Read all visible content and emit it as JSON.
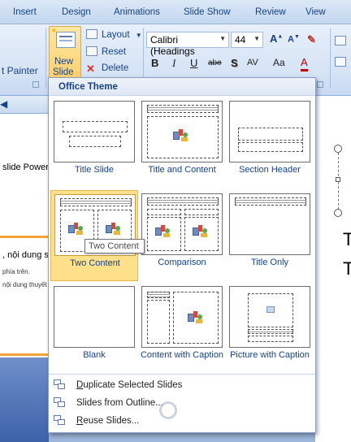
{
  "ribbon_tabs": [
    "Insert",
    "Design",
    "Animations",
    "Slide Show",
    "Review",
    "View"
  ],
  "clipboard": {
    "format_painter_label": "t Painter"
  },
  "slides_group": {
    "new_slide_line1": "New",
    "new_slide_line2": "Slide",
    "layout_label": "Layout",
    "reset_label": "Reset",
    "delete_label": "Delete"
  },
  "font_group": {
    "font_name": "Calibri (Headings",
    "font_size": "44",
    "bold": "B",
    "italic": "I",
    "underline": "U",
    "strike": "abe",
    "shadow": "S",
    "spacing": "AV",
    "change_case": "Aa",
    "font_color": "A",
    "grow": "A",
    "shrink": "A"
  },
  "left_pane": {
    "text1": "slide PowerP",
    "text2": ", nội dung sli",
    "text3": "phía trên.",
    "text4": "nội dung thuyết"
  },
  "slide_area": {
    "text1": "T",
    "text2": "T"
  },
  "dropdown": {
    "header": "Office Theme",
    "layouts": [
      {
        "label": "Title Slide"
      },
      {
        "label": "Title and Content"
      },
      {
        "label": "Section Header"
      },
      {
        "label": "Two Content"
      },
      {
        "label": "Comparison"
      },
      {
        "label": "Title Only"
      },
      {
        "label": "Blank"
      },
      {
        "label": "Content with Caption"
      },
      {
        "label": "Picture with Caption"
      }
    ],
    "selected": "Two Content",
    "tooltip": "Two Content",
    "commands": [
      {
        "underline": "D",
        "rest": "uplicate Selected Slides"
      },
      {
        "underline": "",
        "rest": "Slides from Outline..."
      },
      {
        "underline": "R",
        "rest": "euse Slides..."
      }
    ]
  },
  "colors": {
    "selected_fill": "#ffe08a",
    "header_text": "#15428b",
    "ribbon_bg": "#d5e3f5"
  }
}
